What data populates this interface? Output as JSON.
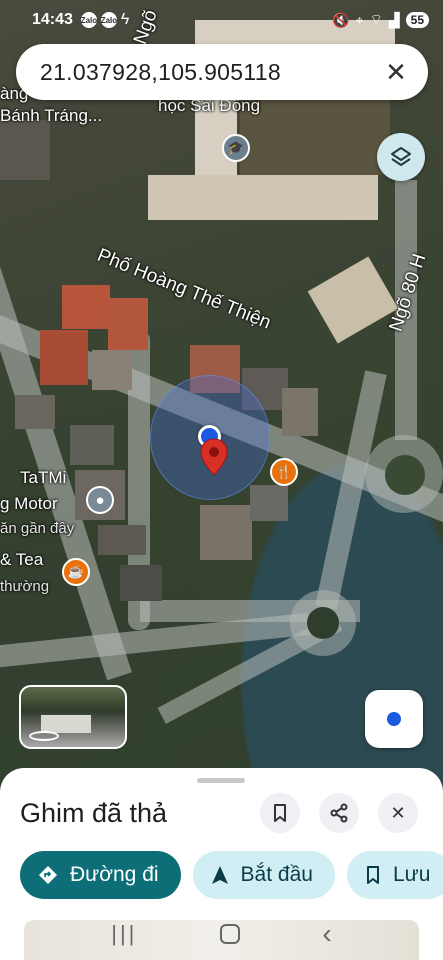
{
  "status_bar": {
    "time": "14:43",
    "app_badges": [
      "Zalo",
      "Zalo"
    ],
    "battery": "55"
  },
  "search": {
    "value": "21.037928,105.905118"
  },
  "map": {
    "labels": {
      "ngo_top": "Ngõ",
      "banh_trang": "Bánh Tráng...",
      "school": "học Sài Đồng",
      "street_main": "Phố Hoàng Thế Thiện",
      "ngo_80": "Ngõ 80 H",
      "tatmi": "TaTMi",
      "motor": "g Motor",
      "motor_sub": "ăn gần đây",
      "tea": "& Tea",
      "tea_sub": "thường",
      "ang": "àng"
    },
    "colors": {
      "accent": "#1a5ae0",
      "pin": "#d93025",
      "food_poi": "#e8710a"
    }
  },
  "sheet": {
    "title": "Ghim đã thả",
    "actions": [
      {
        "label": "Đường đi",
        "icon": "directions-icon"
      },
      {
        "label": "Bắt đầu",
        "icon": "navigation-arrow-icon"
      },
      {
        "label": "Lưu",
        "icon": "bookmark-icon"
      }
    ]
  },
  "colors": {
    "primary_chip": "#0e6e78",
    "secondary_chip": "#d0eef4"
  }
}
